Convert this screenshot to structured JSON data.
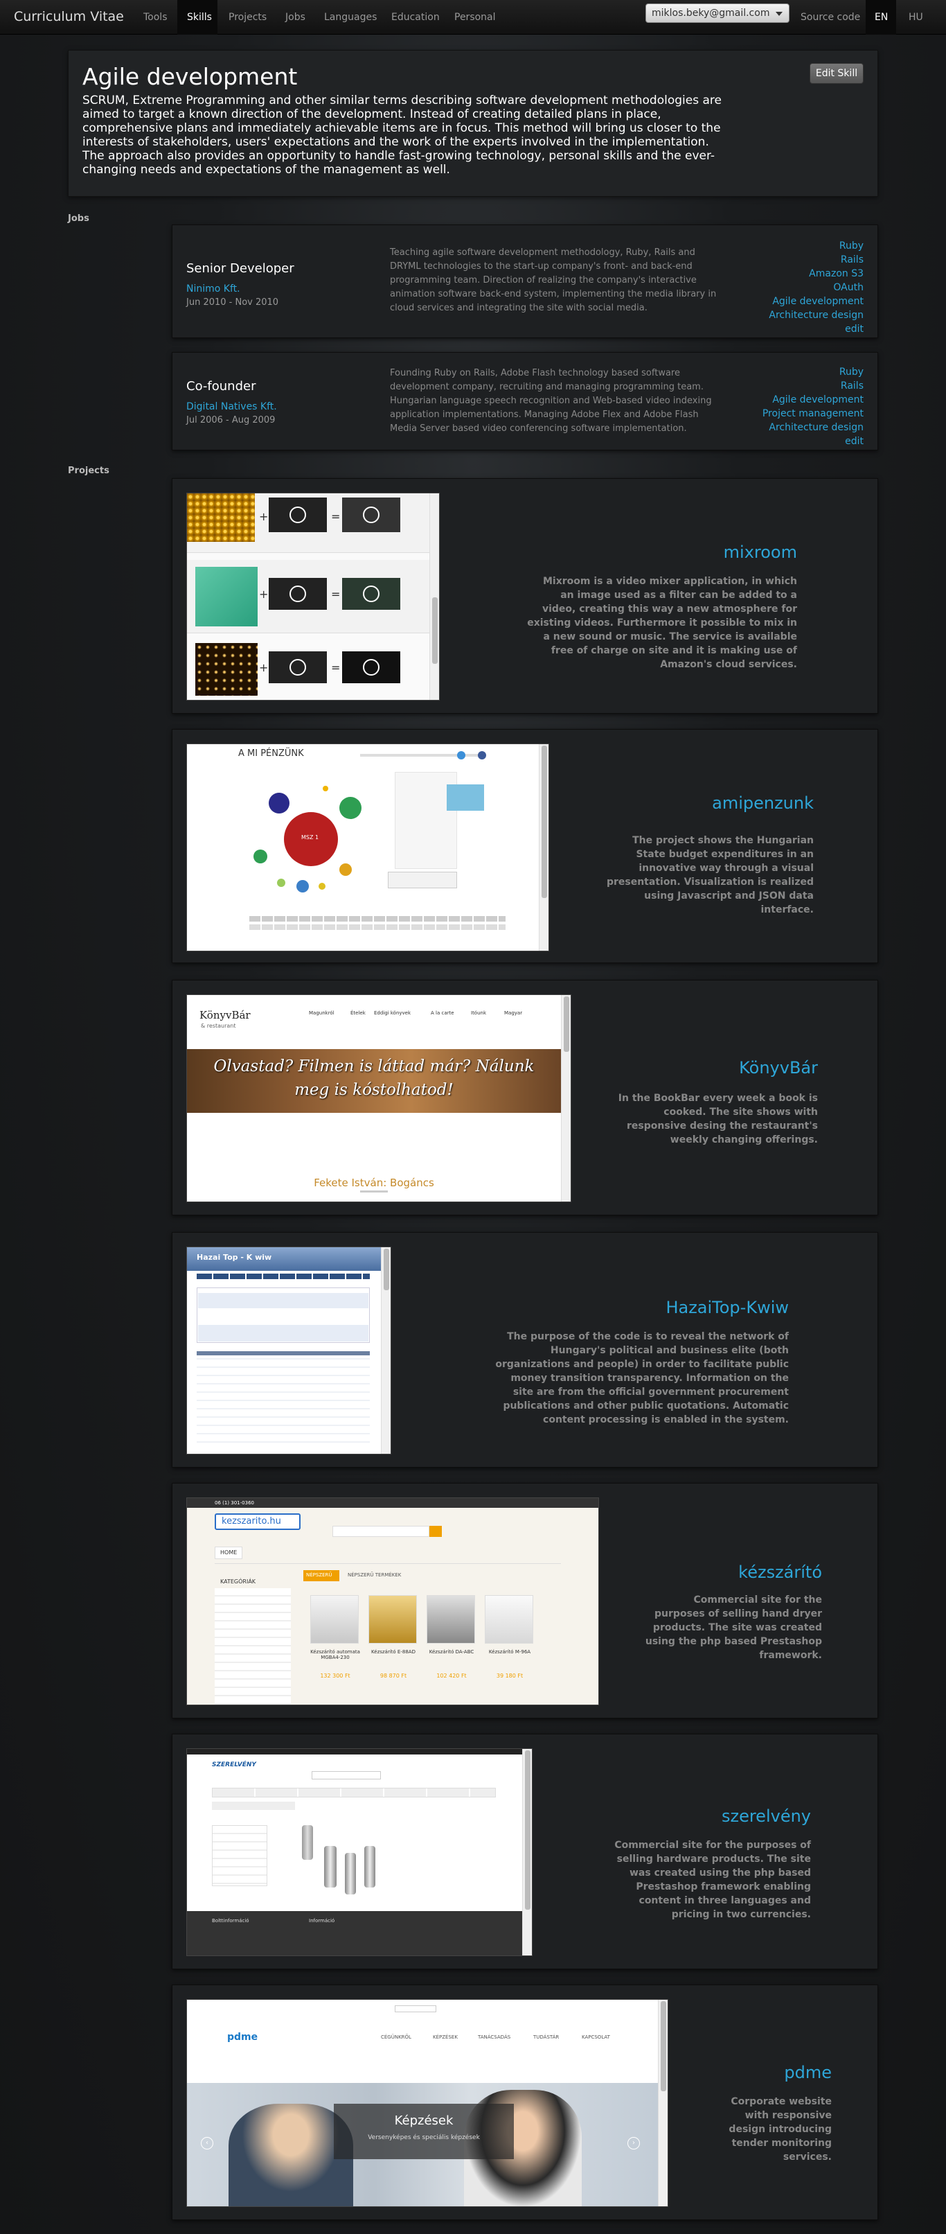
{
  "navbar": {
    "brand": "Curriculum Vitae",
    "items": [
      "Tools",
      "Skills",
      "Projects",
      "Jobs",
      "Languages",
      "Education",
      "Personal"
    ],
    "active": "Skills",
    "email": "miklos.beky@gmail.com",
    "source_code": "Source code",
    "lang_en": "EN",
    "lang_hu": "HU"
  },
  "skill": {
    "title": "Agile development",
    "description": "SCRUM, Extreme Programming and other similar terms describing software development methodologies are aimed to target a known direction of the development. Instead of creating detailed plans in place, comprehensive plans and immediately achievable items are in focus. This method will bring us closer to the interests of stakeholders, users' expectations and the work of the experts involved in the implementation. The approach also provides an opportunity to handle fast-growing technology, personal skills and the ever-changing needs and expectations of the management as well.",
    "edit_label": "Edit Skill"
  },
  "sections": {
    "jobs": "Jobs",
    "projects": "Projects"
  },
  "jobs": [
    {
      "role": "Senior Developer",
      "company": "Ninimo Kft.",
      "dates": "Jun 2010 - Nov 2010",
      "description": "Teaching agile software development methodology, Ruby, Rails and DRYML technologies to the start-up company's front- and back-end programming team. Direction of realizing the company's interactive animation software back-end system, implementing the media library in cloud services and integrating the site with social media.",
      "tags": [
        "Ruby",
        "Rails",
        "Amazon S3",
        "OAuth",
        "Agile development",
        "Architecture design",
        "edit"
      ]
    },
    {
      "role": "Co-founder",
      "company": "Digital Natives Kft.",
      "dates": "Jul 2006 - Aug 2009",
      "description": "Founding Ruby on Rails, Adobe Flash technology based software development company, recruiting and managing programming team. Hungarian language speech recognition and Web-based video indexing application implementations. Managing Adobe Flex and Adobe Flash Media Server based video conferencing software implementation.",
      "tags": [
        "Ruby",
        "Rails",
        "Agile development",
        "Project management",
        "Architecture design",
        "edit"
      ]
    }
  ],
  "projects": [
    {
      "name": "mixroom",
      "description": "Mixroom is a video mixer application, in which an image used as a filter can be added to a video, creating this way a new atmosphere for existing videos. Furthermore it possible to mix in a new sound or music. The service is available free of charge on site and it is making use of Amazon's cloud services."
    },
    {
      "name": "amipenzunk",
      "description": "The project shows the Hungarian State budget expenditures in an innovative way through a visual presentation. Visualization is realized using Javascript and JSON data interface.",
      "shot": {
        "title": "A MI PÉNZÜNK",
        "center": "MSZ 1"
      }
    },
    {
      "name": "KönyvBár",
      "description": "In the BookBar every week a book is cooked. The site shows with responsive desing the restaurant's weekly changing offerings.",
      "shot": {
        "logo": "KönyvBár",
        "logo_sub": "& restaurant",
        "menu": [
          "Magunkról",
          "Ételek",
          "Eddigi könyvek",
          "A la carte",
          "Itóunk",
          "Magyar"
        ],
        "banner": "Olvastad? Filmen is láttad már? Nálunk meg is kóstolhatod!",
        "caption": "Fekete István: Bogáncs"
      }
    },
    {
      "name": "HazaiTop-Kwiw",
      "description": "The purpose of the code is to reveal the network of Hungary's political and business elite (both organizations and people) in order to facilitate public money transition transparency. Information on the site are from the official government procurement publications and other public quotations. Automatic content processing is enabled in the system.",
      "shot": {
        "title": "Hazai Top - K wiw"
      }
    },
    {
      "name": "kézszárító",
      "description": "Commercial site for the purposes of selling hand dryer products. The site was created using the php based Prestashop framework.",
      "shot": {
        "phone": "06 (1) 301-0360",
        "logo": "kezszarito.hu",
        "home": "HOME",
        "categories": "KATEGÓRIÁK",
        "tab_popular": "NÉPSZERŰ",
        "tab_products": "NÉPSZERŰ TERMÉKEK",
        "products": [
          {
            "name": "Kézszárító automata MGBA4-230",
            "price": "132 300 Ft"
          },
          {
            "name": "Kézszárító E-88AD",
            "price": "98 870 Ft"
          },
          {
            "name": "Kézszárító DA-ABC",
            "price": "102 420 Ft"
          },
          {
            "name": "Kézszárító M-96A",
            "price": "39 180 Ft"
          }
        ]
      }
    },
    {
      "name": "szerelvény",
      "description": "Commercial site for the purposes of selling hardware products. The site was created using the php based Prestashop framework enabling content in three languages and pricing in two currencies.",
      "shot": {
        "logo": "SZERELVÉNY",
        "footer_left": "Bolttinformáció",
        "footer_right": "Információ"
      }
    },
    {
      "name": "pdme",
      "description": "Corporate website with responsive design introducing tender monitoring services.",
      "shot": {
        "logo": "pdme",
        "menu": [
          "CÉGÜNKRŐL",
          "KÉPZÉSEK",
          "TANÁCSADÁS",
          "TUDÁSTÁR",
          "KAPCSOLAT"
        ],
        "banner_title": "Képzések",
        "banner_sub": "Versenyképes és speciális képzések"
      }
    }
  ]
}
